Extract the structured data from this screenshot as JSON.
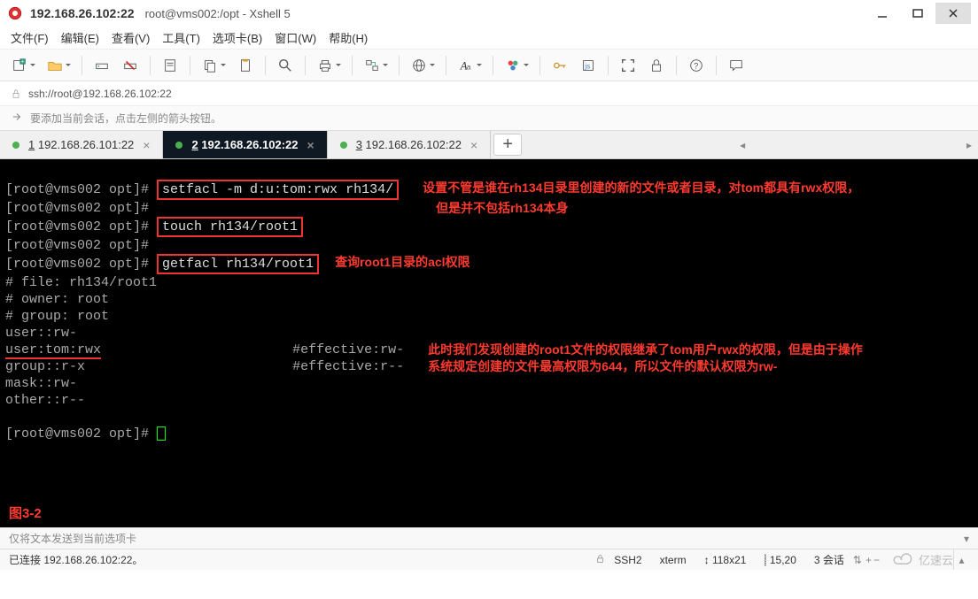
{
  "window": {
    "title_main": "192.168.26.102:22",
    "title_sub": "root@vms002:/opt - Xshell 5"
  },
  "menu": {
    "file": "文件(F)",
    "edit": "编辑(E)",
    "view": "查看(V)",
    "tools": "工具(T)",
    "tab": "选项卡(B)",
    "window": "窗口(W)",
    "help": "帮助(H)"
  },
  "address": {
    "url": "ssh://root@192.168.26.102:22"
  },
  "hint": {
    "text": "要添加当前会话，点击左侧的箭头按钮。"
  },
  "tabs": [
    {
      "digit": "1",
      "label": " 192.168.26.101:22",
      "active": false
    },
    {
      "digit": "2",
      "label": " 192.168.26.102:22",
      "active": true
    },
    {
      "digit": "3",
      "label": " 192.168.26.102:22",
      "active": false
    }
  ],
  "terminal": {
    "prompt": "[root@vms002 opt]# ",
    "cmd1": "setfacl -m d:u:tom:rwx rh134/",
    "cmd2": "touch rh134/root1",
    "cmd3": "getfacl rh134/root1",
    "note1a": "设置不管是谁在rh134目录里创建的新的文件或者目录，对tom都具有rwx权限，",
    "note1b": "但是并不包括rh134本身",
    "note2": "查询root1目录的acl权限",
    "out_file": "# file: rh134/root1",
    "out_owner": "# owner: root",
    "out_group": "# group: root",
    "out_user": "user::rw-",
    "out_usertom": "user:tom:rwx",
    "out_eff1": "#effective:rw-",
    "out_groupperm": "group::r-x",
    "out_eff2": "#effective:r--",
    "out_mask": "mask::rw-",
    "out_other": "other::r--",
    "note3a": "此时我们发现创建的root1文件的权限继承了tom用户rwx的权限，但是由于操作",
    "note3b": "系统规定创建的文件最高权限为644，所以文件的默认权限为rw-",
    "fig": "图3-2"
  },
  "status_hint": "仅将文本发送到当前选项卡",
  "statusbar": {
    "conn": "已连接 192.168.26.102:22。",
    "proto": "SSH2",
    "term": "xterm",
    "size": "118x21",
    "pos": "15,20",
    "sessions": "3 会话",
    "brand": "亿速云"
  }
}
